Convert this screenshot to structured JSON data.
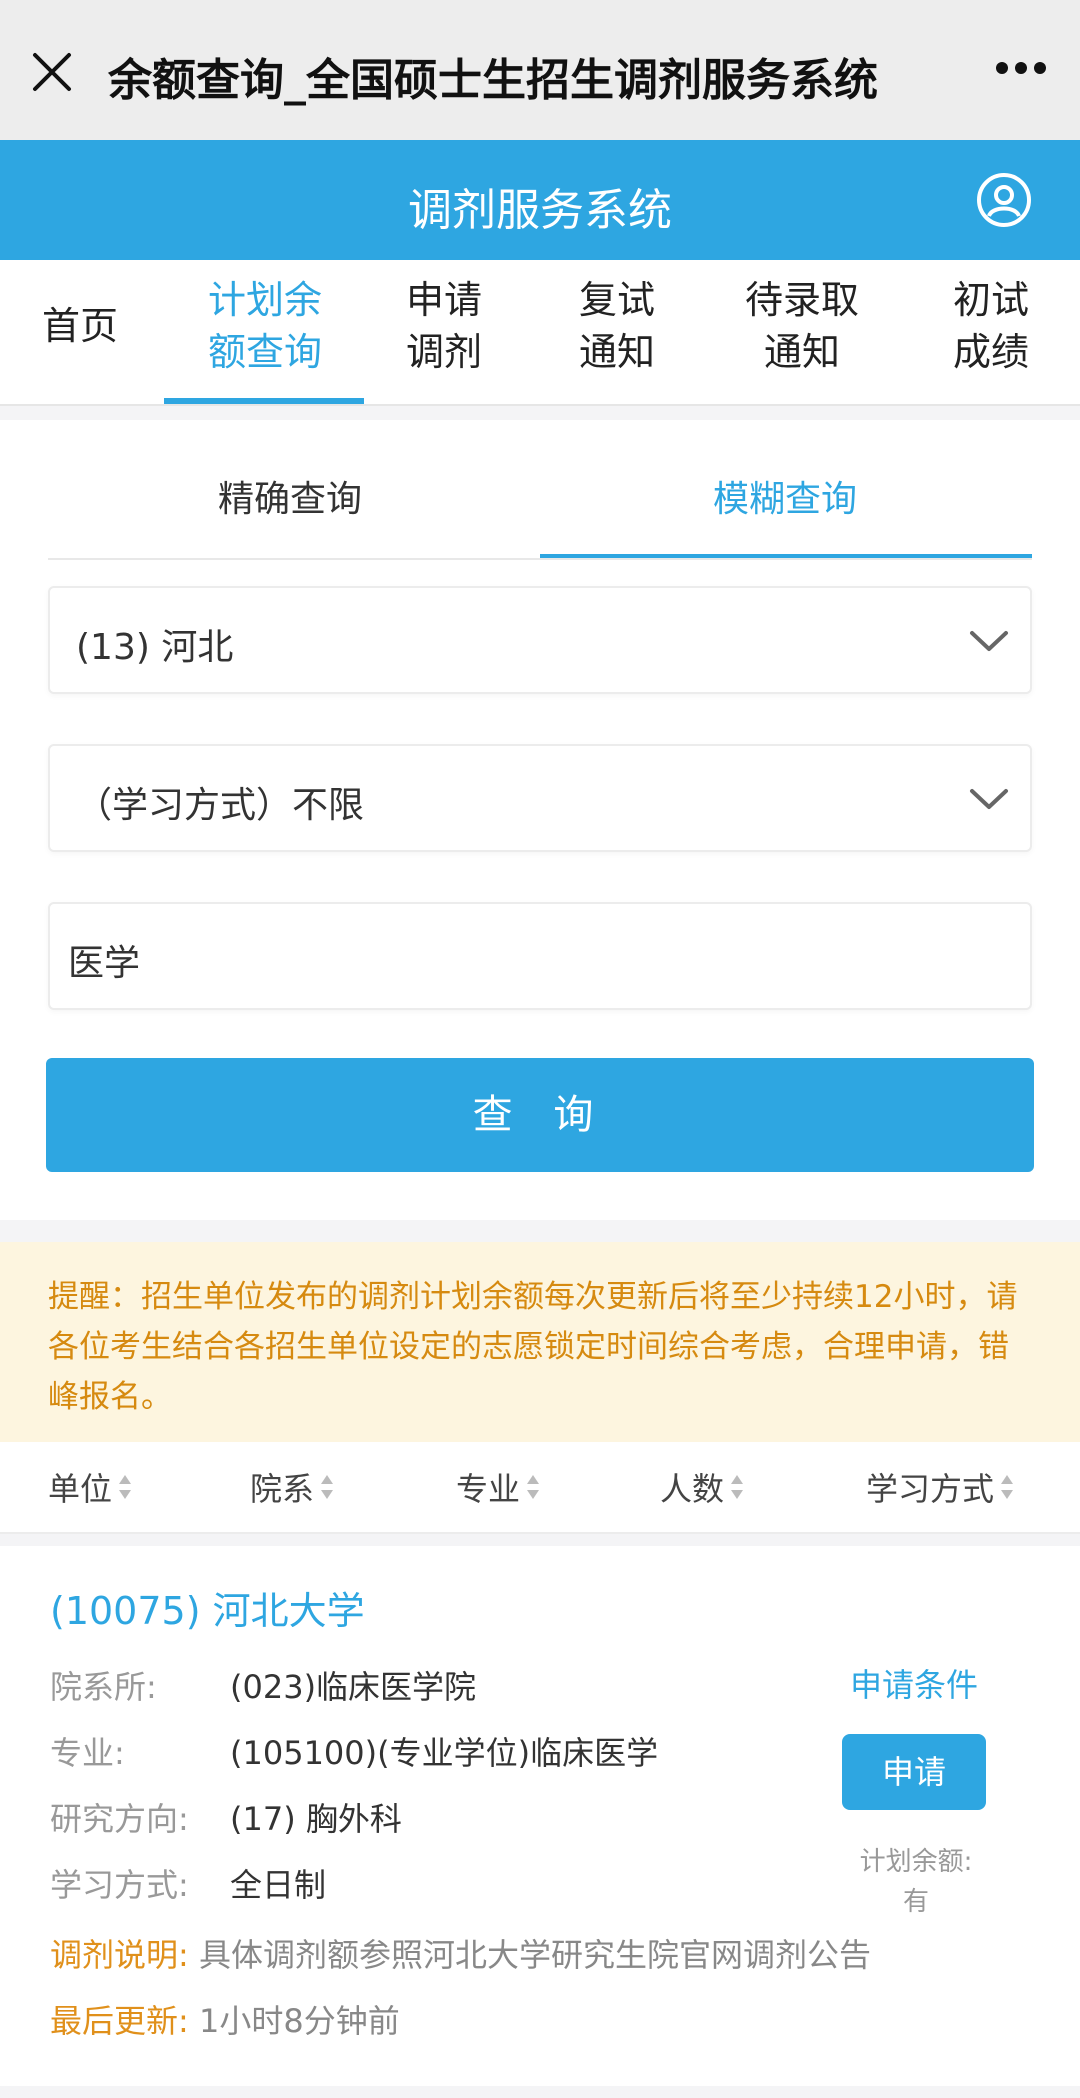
{
  "window": {
    "title": "余额查询_全国硕士生招生调剂服务系统"
  },
  "app": {
    "title": "调剂服务系统"
  },
  "nav": {
    "items": [
      {
        "label": "首页"
      },
      {
        "label": "计划余\n额查询"
      },
      {
        "label": "申请\n调剂"
      },
      {
        "label": "复试\n通知"
      },
      {
        "label": "待录取\n通知"
      },
      {
        "label": "初试\n成绩"
      }
    ],
    "active_index": 1
  },
  "query": {
    "tabs": [
      "精确查询",
      "模糊查询"
    ],
    "active_tab": 1,
    "province": "(13) 河北",
    "study_mode": "（学习方式）不限",
    "keyword": "医学",
    "submit_label": "查 询"
  },
  "notice": {
    "text": "提醒：招生单位发布的调剂计划余额每次更新后将至少持续12小时，请各位考生结合各招生单位设定的志愿锁定时间综合考虑，合理申请，错峰报名。"
  },
  "table": {
    "columns": [
      "单位",
      "院系",
      "专业",
      "人数",
      "学习方式"
    ]
  },
  "result": {
    "unit": "(10075) 河北大学",
    "rows": [
      {
        "label": "院系所:",
        "value": "(023)临床医学院"
      },
      {
        "label": "专业:",
        "value": "(105100)(专业学位)临床医学"
      },
      {
        "label": "研究方向:",
        "value": "(17) 胸外科"
      },
      {
        "label": "学习方式:",
        "value": "全日制"
      },
      {
        "label": "调剂说明:",
        "value": "具体调剂额参照河北大学研究生院官网调剂公告"
      },
      {
        "label": "最后更新:",
        "value": "1小时8分钟前"
      }
    ],
    "condition_link": "申请条件",
    "apply_label": "申请",
    "quota_label": "计划余额:",
    "quota_value": "有"
  },
  "colors": {
    "primary": "#2ea6e1",
    "notice_bg": "#fdf5df",
    "notice_text": "#d68a10",
    "highlight_label": "#e0901b"
  },
  "icons": {
    "close": "close-icon",
    "more": "more-icon",
    "user": "user-icon",
    "dropdown": "chevron-down-icon",
    "sort": "sort-icon"
  }
}
